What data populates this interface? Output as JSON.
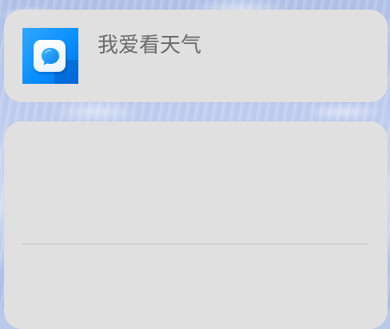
{
  "app_card": {
    "icon_name": "weather-app-icon",
    "icon_color": "#0a8fff",
    "app_name": "我爱看天气"
  },
  "widget_card": {
    "content": ""
  },
  "colors": {
    "card_background": "#e0e0e0",
    "text": "#6b6b6b",
    "wallpaper": "#b9c9ea"
  }
}
